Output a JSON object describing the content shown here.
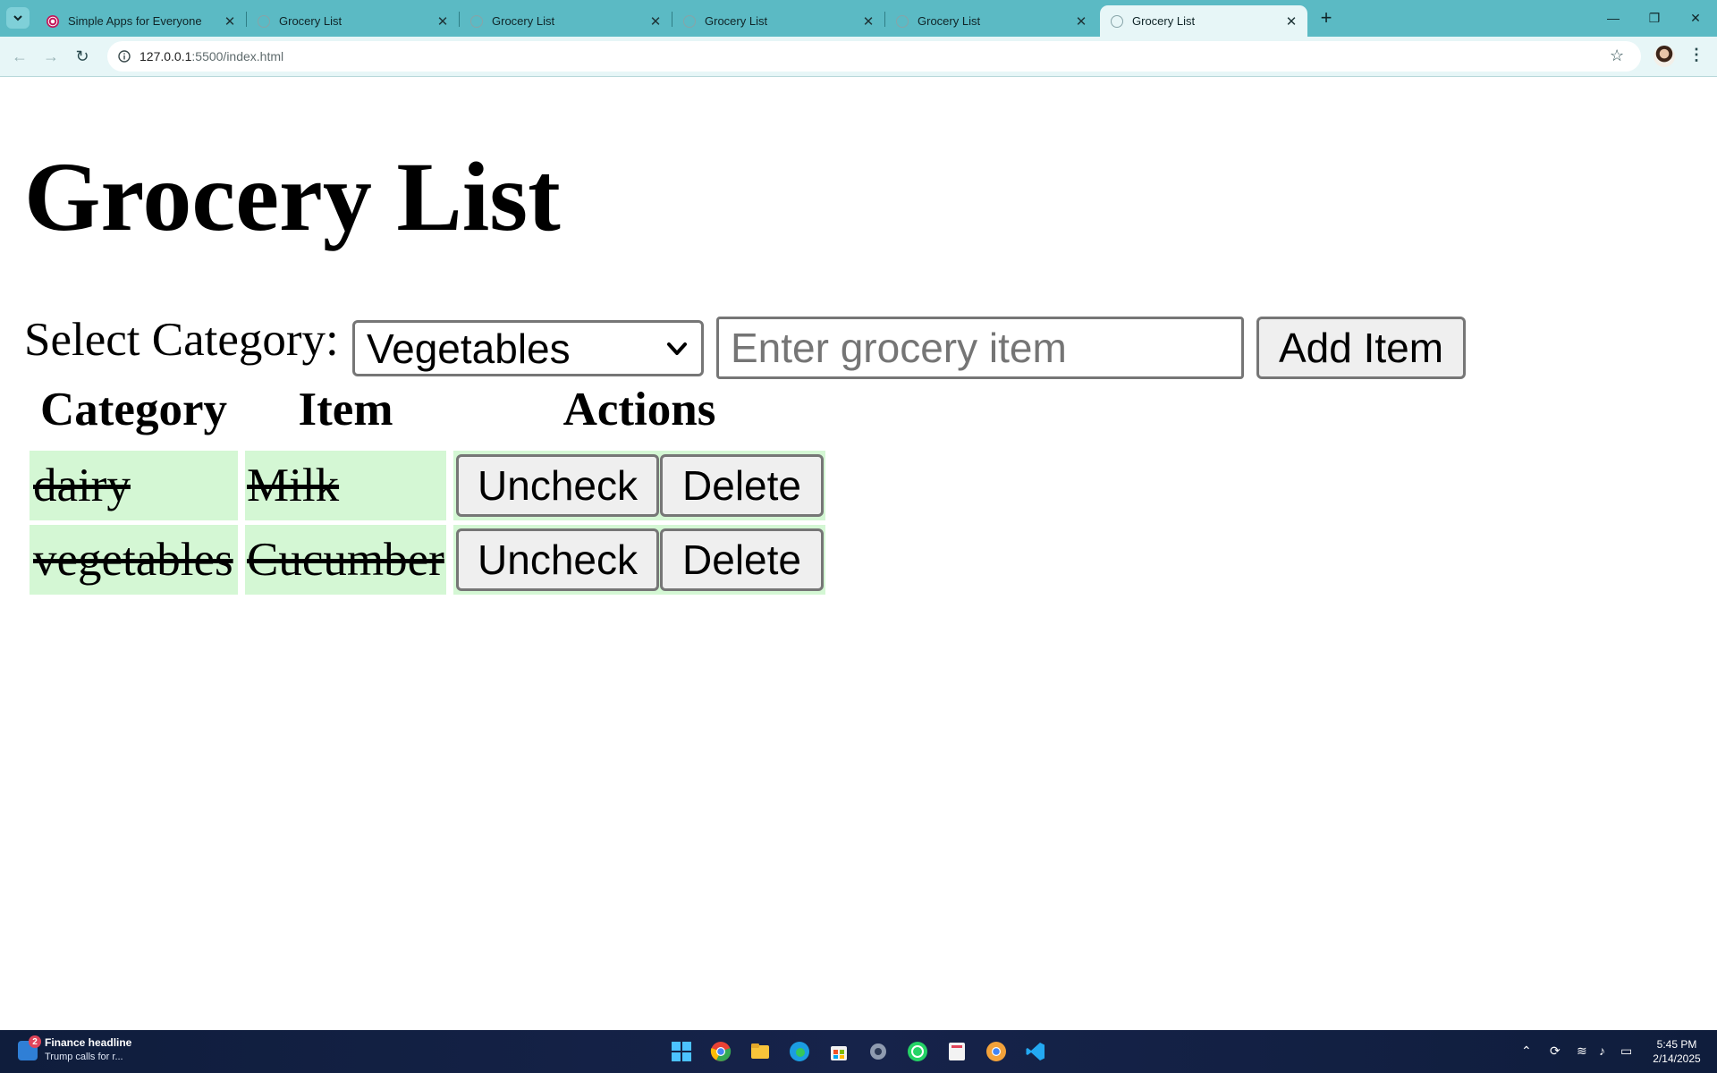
{
  "browser": {
    "tabs": [
      {
        "title": "Simple Apps for Everyone",
        "active": false
      },
      {
        "title": "Grocery List",
        "active": false
      },
      {
        "title": "Grocery List",
        "active": false
      },
      {
        "title": "Grocery List",
        "active": false
      },
      {
        "title": "Grocery List",
        "active": false
      },
      {
        "title": "Grocery List",
        "active": true
      }
    ],
    "url_host": "127.0.0.1",
    "url_rest": ":5500/index.html"
  },
  "page": {
    "title": "Grocery List",
    "select_label": "Select Category:",
    "selected_category": "Vegetables",
    "item_placeholder": "Enter grocery item",
    "add_button": "Add Item",
    "table": {
      "headers": [
        "Category",
        "Item",
        "Actions"
      ],
      "rows": [
        {
          "category": "dairy",
          "item": "Milk",
          "checked": true,
          "toggle_label": "Uncheck",
          "delete_label": "Delete"
        },
        {
          "category": "vegetables",
          "item": "Cucumber",
          "checked": true,
          "toggle_label": "Uncheck",
          "delete_label": "Delete"
        }
      ]
    },
    "row_color": "#d4f7d4"
  },
  "taskbar": {
    "news_badge": "2",
    "news_title": "Finance headline",
    "news_text": "Trump calls for r...",
    "time": "5:45 PM",
    "date": "2/14/2025"
  }
}
